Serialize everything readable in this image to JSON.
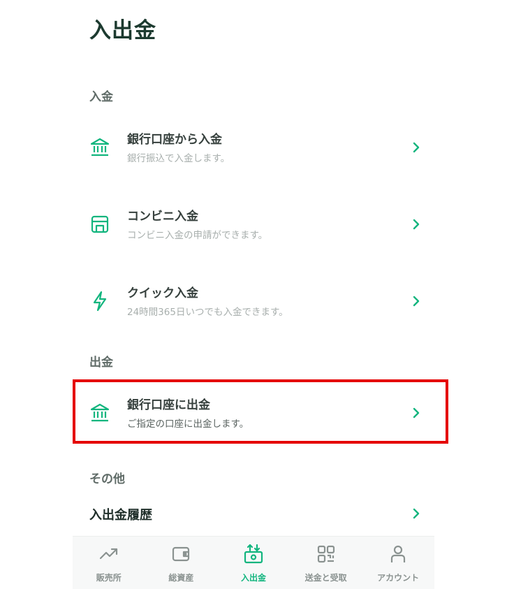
{
  "header": {
    "title": "入出金"
  },
  "sections": {
    "deposit": {
      "title": "入金",
      "items": [
        {
          "title": "銀行口座から入金",
          "subtitle": "銀行振込で入金します。",
          "icon": "bank-icon"
        },
        {
          "title": "コンビニ入金",
          "subtitle": "コンビニ入金の申請ができます。",
          "icon": "store-icon"
        },
        {
          "title": "クイック入金",
          "subtitle": "24時間365日いつでも入金できます。",
          "icon": "lightning-icon"
        }
      ]
    },
    "withdraw": {
      "title": "出金",
      "items": [
        {
          "title": "銀行口座に出金",
          "subtitle": "ご指定の口座に出金します。",
          "icon": "bank-icon",
          "highlighted": true
        }
      ]
    },
    "other": {
      "title": "その他",
      "items": [
        {
          "title": "入出金履歴"
        }
      ]
    }
  },
  "tabbar": {
    "tabs": [
      {
        "label": "販売所",
        "icon": "trend-icon",
        "active": false
      },
      {
        "label": "総資産",
        "icon": "wallet-icon",
        "active": false
      },
      {
        "label": "入出金",
        "icon": "money-transfer-icon",
        "active": true
      },
      {
        "label": "送金と受取",
        "icon": "qr-code-icon",
        "active": false
      },
      {
        "label": "アカウント",
        "icon": "person-icon",
        "active": false
      }
    ]
  },
  "colors": {
    "accent": "#12b57e",
    "highlight_border": "#e50000",
    "title_text": "#1c3a2f",
    "inactive_tab": "#8a9290"
  }
}
